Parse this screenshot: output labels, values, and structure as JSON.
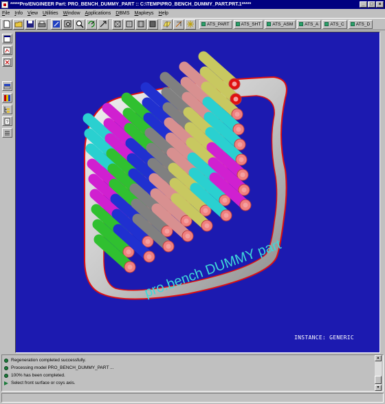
{
  "window": {
    "title": "*****Pro/ENGINEER Part: PRO_BENCH_DUMMY_PART :: C:\\TEMP\\PRO_BENCH_DUMMY_PART.PRT.1*****",
    "minimize": "_",
    "maximize": "□",
    "close": "×"
  },
  "menubar": {
    "items": [
      "File",
      "Info",
      "View",
      "Utilities",
      "Window",
      "Applications",
      "DBMS",
      "Mapkeys",
      "Help"
    ]
  },
  "toolbar": {
    "icons": [
      "new-file-icon",
      "open-folder-icon",
      "save-icon",
      "print-icon",
      "repaint-icon",
      "zoom-in-icon",
      "zoom-out-icon",
      "spin-icon",
      "orient-icon",
      "datum-plane-icon",
      "datum-axis-icon",
      "datum-point-icon",
      "csys-icon",
      "wireframe-icon",
      "hidden-line-icon",
      "no-hidden-icon",
      "shaded-icon",
      "spin-center-icon",
      "model-tree-icon",
      "star-icon"
    ],
    "ats_buttons": [
      "ATS_PART",
      "ATS_SHT",
      "ATS_ASM",
      "ATS_A",
      "ATS_C",
      "ATS_D"
    ]
  },
  "left_toolbar": {
    "icons": [
      "window-icon",
      "sketch-icon",
      "delete-icon",
      "layer-icon",
      "color-icon",
      "tree-icon",
      "info-icon",
      "list-icon"
    ]
  },
  "viewport": {
    "background": "#1c1ab0",
    "model_label": "pro.bench DUMMY part",
    "instance_label": "INSTANCE: GENERIC"
  },
  "messages": [
    "Regeneration completed successfully.",
    "Processing model PRO_BENCH_DUMMY_PART ...",
    "100% has been completed.",
    "Select front surface or csys axis."
  ],
  "colors": {
    "tube_colors": [
      "#2ad0d0",
      "#d020d0",
      "#30c030",
      "#2030d0",
      "#808080",
      "#d89090",
      "#c8c860"
    ],
    "rim": "#e01010",
    "shell": "#c0c0c0"
  }
}
